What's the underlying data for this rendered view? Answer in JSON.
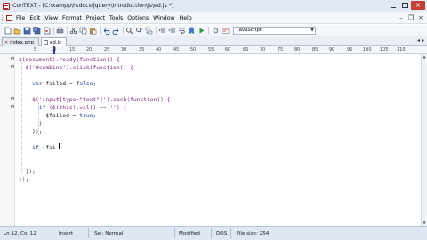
{
  "window": {
    "title": "ConTEXT - [C:\\xampp\\htdocs\\jquery\\introduction\\js\\ed.js *]",
    "controls": [
      "minimize",
      "maximize",
      "close"
    ]
  },
  "menu": {
    "items": [
      "File",
      "Edit",
      "View",
      "Format",
      "Project",
      "Tools",
      "Options",
      "Window",
      "Help"
    ]
  },
  "toolbar": {
    "buttons": [
      "new-icon",
      "open-icon",
      "save-icon",
      "save-all-icon",
      "close-icon",
      "print-icon",
      "cut-icon",
      "copy-icon",
      "paste-icon",
      "undo-icon",
      "redo-icon",
      "find-icon",
      "replace-icon",
      "word-wrap-icon"
    ],
    "language_selected": "JavaScript"
  },
  "tabs": [
    {
      "label": "index.php",
      "active": false
    },
    {
      "label": "ed.js",
      "active": true
    }
  ],
  "ruler": {
    "labels": [
      "5",
      "10",
      "15",
      "20",
      "25",
      "30",
      "35",
      "40",
      "45",
      "50",
      "55",
      "60",
      "65",
      "70",
      "75",
      "80",
      "85",
      "90",
      "95",
      "100",
      "105",
      "110"
    ],
    "cursor_column": 12
  },
  "editor": {
    "lines": [
      [
        {
          "t": "$(document).ready(function() {",
          "c": "sel"
        }
      ],
      [
        {
          "t": "  $('#combine').click(function() {",
          "c": "sel"
        }
      ],
      [
        {
          "t": "",
          "c": "var"
        }
      ],
      [
        {
          "t": "    ",
          "c": "var"
        },
        {
          "t": "var",
          "c": "kw"
        },
        {
          "t": " failed = ",
          "c": "var"
        },
        {
          "t": "false",
          "c": "kw"
        },
        {
          "t": ";",
          "c": "op"
        }
      ],
      [
        {
          "t": "",
          "c": "var"
        }
      ],
      [
        {
          "t": "    $('input[type=\"text\"]').each(function() {",
          "c": "sel"
        }
      ],
      [
        {
          "t": "      ",
          "c": "var"
        },
        {
          "t": "if",
          "c": "kw"
        },
        {
          "t": " ($(this).val() == '') {",
          "c": "sel"
        }
      ],
      [
        {
          "t": "        $failed = ",
          "c": "var"
        },
        {
          "t": "true",
          "c": "kw"
        },
        {
          "t": ";",
          "c": "op"
        }
      ],
      [
        {
          "t": "      }",
          "c": "op"
        }
      ],
      [
        {
          "t": "    });",
          "c": "op"
        }
      ],
      [
        {
          "t": "",
          "c": "var"
        }
      ],
      [
        {
          "t": "    ",
          "c": "var"
        },
        {
          "t": "if",
          "c": "kw"
        },
        {
          "t": " (fai",
          "c": "var"
        }
      ],
      [
        {
          "t": "",
          "c": "var"
        }
      ],
      [
        {
          "t": "",
          "c": "var"
        }
      ],
      [
        {
          "t": "  });",
          "c": "op"
        }
      ],
      [
        {
          "t": "});",
          "c": "op"
        }
      ]
    ]
  },
  "colors": {
    "selector": "#7a1f7a",
    "keyword": "#1f3a9a",
    "string": "#2a6a2a",
    "operator": "#555555",
    "chrome": "#dfe8f3"
  },
  "status": {
    "position": "Ln 12, Col 12",
    "insert_mode": "Insert",
    "selection_mode": "Sel: Normal",
    "modified": "Modified",
    "line_endings": "DOS",
    "file_size": "File size: 254"
  }
}
